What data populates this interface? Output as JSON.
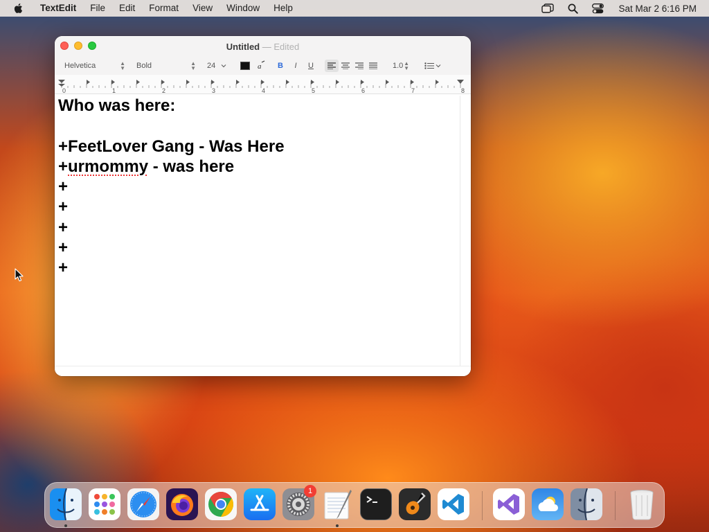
{
  "menubar": {
    "app_name": "TextEdit",
    "items": [
      "File",
      "Edit",
      "Format",
      "View",
      "Window",
      "Help"
    ],
    "clock": "Sat Mar 2  6:16 PM"
  },
  "window": {
    "title": "Untitled",
    "separator": "—",
    "edited": "Edited",
    "toolbar": {
      "font_family": "Helvetica",
      "font_style": "Bold",
      "font_size": "24",
      "text_color": "#111111",
      "bold_label": "B",
      "italic_label": "I",
      "underline_label": "U",
      "line_spacing": "1.0"
    },
    "ruler_numbers": [
      "0",
      "1",
      "2",
      "3",
      "4",
      "5",
      "6",
      "7",
      "8"
    ]
  },
  "document": {
    "lines": [
      "Who was here:",
      "",
      "+FeetLover Gang - Was Here",
      "+",
      "+",
      "+",
      "+",
      "+",
      "+"
    ],
    "line4": {
      "prefix": "+",
      "misspelled": "urmommy",
      "suffix": " - was here"
    }
  },
  "dock": {
    "apps": [
      {
        "name": "Finder",
        "running": true
      },
      {
        "name": "Launchpad",
        "running": false
      },
      {
        "name": "Safari",
        "running": false
      },
      {
        "name": "Firefox",
        "running": false
      },
      {
        "name": "Chrome",
        "running": false
      },
      {
        "name": "App Store",
        "running": false
      },
      {
        "name": "System Settings",
        "running": false,
        "badge": "1"
      },
      {
        "name": "TextEdit",
        "running": true
      },
      {
        "name": "Terminal",
        "running": false
      },
      {
        "name": "GarageBand",
        "running": false
      },
      {
        "name": "Visual Studio Code",
        "running": false
      },
      {
        "name": "Visual Studio",
        "running": false
      },
      {
        "name": "Weather",
        "running": false
      },
      {
        "name": "Finder",
        "running": false
      },
      {
        "name": "Trash",
        "running": false
      }
    ],
    "badge_count": "1"
  },
  "colors": {
    "close": "#fe5f57",
    "minimize": "#febc2e",
    "maximize": "#28c840",
    "accent": "#2d6ad9"
  }
}
